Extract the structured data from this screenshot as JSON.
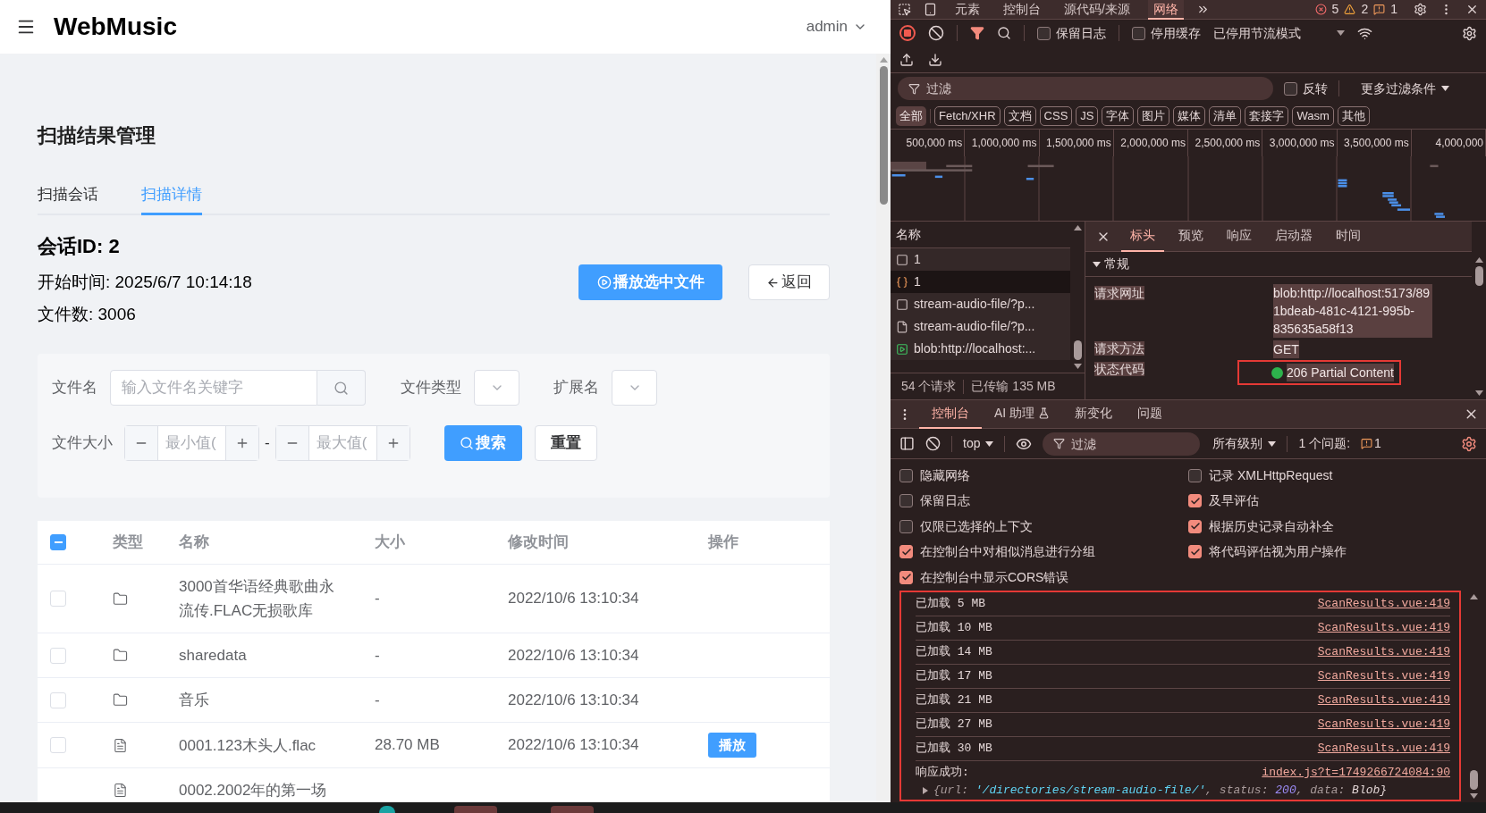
{
  "app": {
    "title": "WebMusic",
    "user": "admin",
    "page_title": "扫描结果管理",
    "tabs": [
      {
        "label": "扫描会话",
        "selected": false
      },
      {
        "label": "扫描详情",
        "selected": true
      }
    ],
    "session": {
      "id_label": "会话ID: 2",
      "start_time": "开始时间: 2025/6/7 10:14:18",
      "file_count": "文件数: 3006"
    },
    "actions": [
      {
        "label": "播放选中文件",
        "kind": "primary"
      },
      {
        "label": "返回",
        "kind": "back"
      }
    ],
    "filters": {
      "name_field": {
        "label": "文件名",
        "placeholder": "输入文件名关键字"
      },
      "type_label": "文件类型",
      "ext_label": "扩展名",
      "size_label": "文件大小",
      "size_min": {
        "placeholder": "最小值("
      },
      "range_separator": "-",
      "size_max": {
        "placeholder": "最大值("
      },
      "search_button": "搜索",
      "reset_button": "重置"
    },
    "table": {
      "select_all": {
        "indeterminate": true
      },
      "columns": [
        "类型",
        "名称",
        "大小",
        "修改时间",
        "操作"
      ],
      "rows": [
        {
          "kind": "folder",
          "checked": false,
          "name": "3000首华语经典歌曲永流传.FLAC无损歌库",
          "size": "-",
          "modified": "2022/10/6 13:10:34"
        },
        {
          "kind": "folder",
          "checked": false,
          "name": "sharedata",
          "size": "-",
          "modified": "2022/10/6 13:10:34"
        },
        {
          "kind": "folder",
          "checked": false,
          "name": "音乐",
          "size": "-",
          "modified": "2022/10/6 13:10:34"
        },
        {
          "kind": "file",
          "checked": false,
          "name": "0001.123木头人.flac",
          "size": "28.70 MB",
          "modified": "2022/10/6 13:10:34",
          "action": "播放"
        },
        {
          "kind": "file",
          "name": "0002.2002年的第一场"
        }
      ]
    }
  },
  "devtools": {
    "top_tabs": [
      {
        "label": "元素",
        "selected": false
      },
      {
        "label": "控制台",
        "selected": false
      },
      {
        "label": "源代码/来源",
        "selected": false
      },
      {
        "label": "网络",
        "selected": true
      }
    ],
    "counts": {
      "errors": "5",
      "warnings": "2",
      "issues": "1"
    },
    "network": {
      "preserve_log": {
        "label": "保留日志",
        "checked": false
      },
      "disable_cache": {
        "label": "停用缓存",
        "checked": false
      },
      "throttling": "已停用节流模式",
      "filter": {
        "placeholder": "过滤"
      },
      "invert": {
        "label": "反转",
        "checked": false
      },
      "more_filters": "更多过滤条件",
      "types": [
        {
          "label": "全部",
          "selected": true
        },
        {
          "label": "Fetch/XHR",
          "selected": false
        },
        {
          "label": "文档",
          "selected": false
        },
        {
          "label": "CSS",
          "selected": false
        },
        {
          "label": "JS",
          "selected": false
        },
        {
          "label": "字体",
          "selected": false
        },
        {
          "label": "图片",
          "selected": false
        },
        {
          "label": "媒体",
          "selected": false
        },
        {
          "label": "清单",
          "selected": false
        },
        {
          "label": "套接字",
          "selected": false
        },
        {
          "label": "Wasm",
          "selected": false
        },
        {
          "label": "其他",
          "selected": false
        }
      ],
      "overview_ticks": [
        "500,000 ms",
        "1,000,000 ms",
        "1,500,000 ms",
        "2,000,000 ms",
        "2,500,000 ms",
        "3,000,000 ms",
        "3,500,000 ms",
        "4,000,000"
      ],
      "name_header": "名称",
      "requests": [
        {
          "kind": "document",
          "name": "1",
          "selected": false
        },
        {
          "kind": "json",
          "name": "1",
          "selected": true
        },
        {
          "kind": "document",
          "name": "stream-audio-file/?p...",
          "selected": false
        },
        {
          "kind": "file",
          "name": "stream-audio-file/?p...",
          "selected": false
        },
        {
          "kind": "media",
          "name": "blob:http://localhost:...",
          "selected": false
        }
      ],
      "summary": [
        "54 个请求",
        "已传输 135 MB"
      ],
      "detail_tabs": [
        {
          "label": "标头",
          "selected": true
        },
        {
          "label": "预览",
          "selected": false
        },
        {
          "label": "响应",
          "selected": false
        },
        {
          "label": "启动器",
          "selected": false
        },
        {
          "label": "时间",
          "selected": false
        }
      ],
      "section": "常规",
      "headers": [
        {
          "name": "请求网址",
          "value": "blob:http://localhost:5173/891bdeab-481c-4121-995b-835635a58f13",
          "highlighted": false
        },
        {
          "name": "请求方法",
          "value": "GET",
          "highlighted": false
        },
        {
          "name": "状态代码",
          "value": "206 Partial Content",
          "color": "#2db14c",
          "highlighted": true
        }
      ]
    },
    "console": {
      "tabs": [
        {
          "label": "控制台",
          "selected": true,
          "kind": "plain"
        },
        {
          "label": "AI 助理",
          "selected": false,
          "kind": "lab"
        },
        {
          "label": "新变化",
          "selected": false,
          "kind": "plain"
        },
        {
          "label": "问题",
          "selected": false,
          "kind": "plain"
        }
      ],
      "context": "top",
      "filter": {
        "placeholder": "过滤"
      },
      "levels": "所有级别",
      "issues_label": "1 个问题:",
      "issues_count": "1",
      "settings_left": [
        {
          "label": "隐藏网络",
          "checked": false
        },
        {
          "label": "保留日志",
          "checked": false
        },
        {
          "label": "仅限已选择的上下文",
          "checked": false
        },
        {
          "label": "在控制台中对相似消息进行分组",
          "checked": true
        },
        {
          "label": "在控制台中显示CORS错误",
          "checked": true
        }
      ],
      "settings_right": [
        {
          "label": "记录 XMLHttpRequest",
          "checked": false
        },
        {
          "label": "及早评估",
          "checked": true
        },
        {
          "label": "根据历史记录自动补全",
          "checked": true
        },
        {
          "label": "将代码评估视为用户操作",
          "checked": true
        }
      ],
      "highlighted": true,
      "messages": [
        {
          "text": "已加载 5 MB",
          "source": "ScanResults.vue:419"
        },
        {
          "text": "已加载 10 MB",
          "source": "ScanResults.vue:419"
        },
        {
          "text": "已加载 14 MB",
          "source": "ScanResults.vue:419"
        },
        {
          "text": "已加载 17 MB",
          "source": "ScanResults.vue:419"
        },
        {
          "text": "已加载 21 MB",
          "source": "ScanResults.vue:419"
        },
        {
          "text": "已加载 27 MB",
          "source": "ScanResults.vue:419"
        },
        {
          "text": "已加载 30 MB",
          "source": "ScanResults.vue:419"
        },
        {
          "text": "响应成功:",
          "source": "index.js?t=1749266724084:90",
          "object_parts": [
            {
              "kind": "key",
              "text": "{url: "
            },
            {
              "kind": "string",
              "text": "'/directories/stream-audio-file/'"
            },
            {
              "kind": "key",
              "text": ", status: "
            },
            {
              "kind": "number",
              "text": "200"
            },
            {
              "kind": "key",
              "text": ", data: "
            },
            {
              "kind": "object",
              "text": "Blob}"
            }
          ]
        }
      ]
    }
  }
}
